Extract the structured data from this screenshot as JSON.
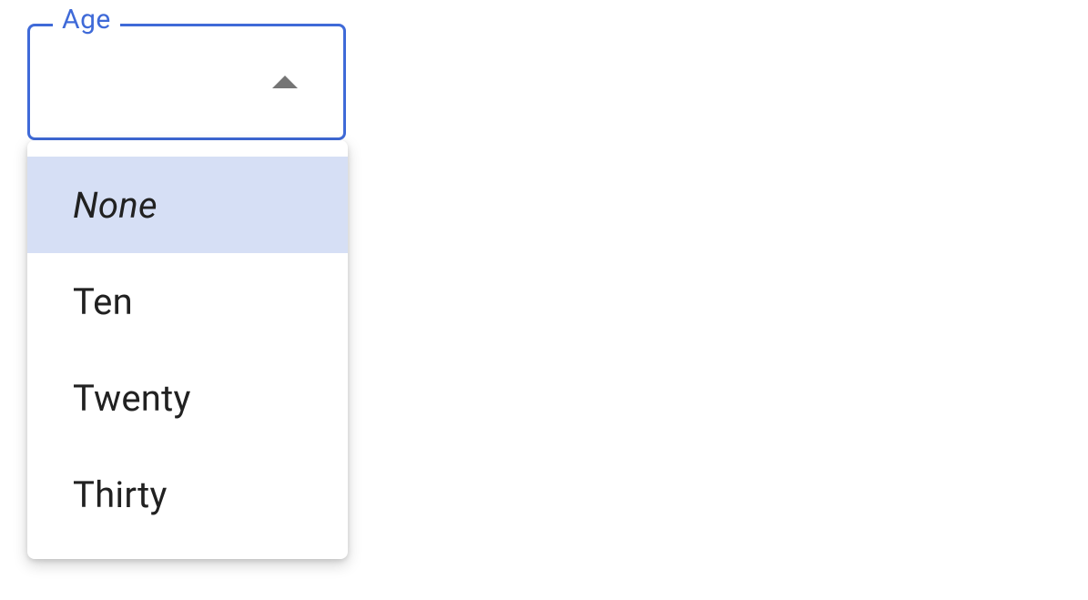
{
  "select": {
    "label": "Age",
    "selected_index": 0,
    "open": true,
    "options": [
      {
        "label": "None",
        "is_none": true
      },
      {
        "label": "Ten",
        "is_none": false
      },
      {
        "label": "Twenty",
        "is_none": false
      },
      {
        "label": "Thirty",
        "is_none": false
      }
    ]
  }
}
